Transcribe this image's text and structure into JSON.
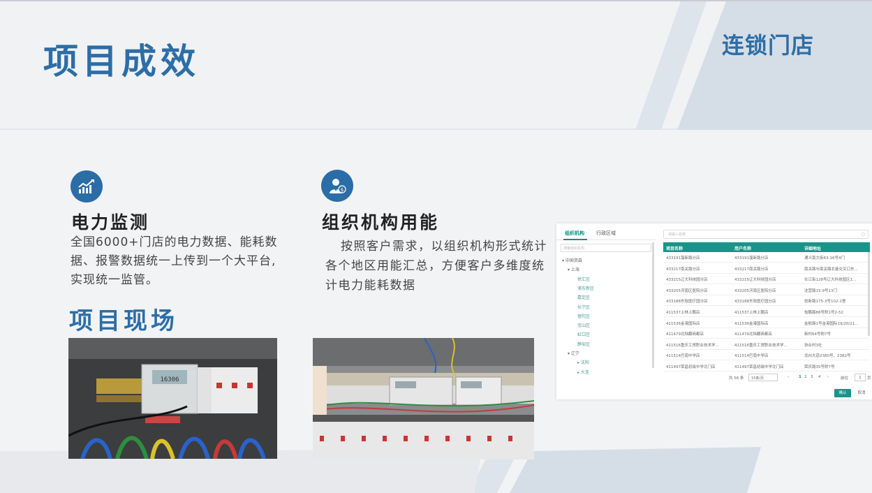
{
  "header": {
    "title": "项目成效",
    "corner_title": "连锁门店"
  },
  "features": [
    {
      "icon": "chart-growth-icon",
      "title": "电力监测",
      "desc_lines": [
        "全国6000+门店的电力数据、能耗数",
        "据、报警数据统一上传到一个大平台,",
        "实现统一监管。"
      ]
    },
    {
      "icon": "user-money-icon",
      "title": "组织机构用能",
      "desc_lines": [
        "按照客户需求，以组织机构形式统计",
        "各个地区用能汇总，方便客户多维度统",
        "计电力能耗数据"
      ]
    }
  ],
  "site_section": {
    "title": "项目现场"
  },
  "app_panel": {
    "tabs": [
      "组织机构",
      "行政区域"
    ],
    "tree_search_placeholder": "搜索组织机构",
    "search_placeholder": "请输入名称",
    "tree": [
      {
        "label": "▾ 中国资森",
        "level": 0
      },
      {
        "label": "▾ 上海",
        "level": 1
      },
      {
        "label": "徐汇区",
        "level": 2
      },
      {
        "label": "浦东新区",
        "level": 2
      },
      {
        "label": "嘉定区",
        "level": 2
      },
      {
        "label": "长宁区",
        "level": 2
      },
      {
        "label": "普陀区",
        "level": 2
      },
      {
        "label": "宝山区",
        "level": 2
      },
      {
        "label": "虹口区",
        "level": 2
      },
      {
        "label": "静安区",
        "level": 2
      },
      {
        "label": "▾ 辽宁",
        "level": 1
      },
      {
        "label": "▸ 沈阳",
        "level": 2
      },
      {
        "label": "▸ 大连",
        "level": 2
      }
    ],
    "columns": [
      "项目名称",
      "用户名称",
      "详细地址"
    ],
    "rows": [
      [
        "433191藻新路分店",
        "433191藻新路分店",
        "通义南大街63-16号4门"
      ],
      [
        "433217南关路分店",
        "433217南关路分店",
        "南关路与南关路北巷交叉口东..."
      ],
      [
        "433215辽大科技园分店",
        "433215辽大科技园分店",
        "长江街128号辽大科技园区1..."
      ],
      [
        "433205河南区医院分店",
        "433205河南区医院分店",
        "沈营路15-9号13门"
      ],
      [
        "433188东软医疗园分店",
        "433188东软医疗园分店",
        "创新路175-3号102-2室"
      ],
      [
        "411537上林上鹏店",
        "411537上林上鹏店",
        "怡鹏路88号附1号2-52"
      ],
      [
        "411536金港国际店",
        "411536金港国际店",
        "金航路1号金港国际19/20/21..."
      ],
      [
        "411479北陆翻商都店",
        "411479北陆翻商都店",
        "新村64号附7号"
      ],
      [
        "411516重庆工贸职业技术学...",
        "411516重庆工贸职业技术学...",
        "协合村3社"
      ],
      [
        "411514巴南中学店",
        "411514巴南中学店",
        "龙州大道2380号、2382号"
      ],
      [
        "411497荣昌初级中学北门店",
        "411497荣昌初级中学北门店",
        "荣庆路35号附7号"
      ]
    ],
    "pager": {
      "total": "共 56 条",
      "page_size": "15条/页",
      "pages": [
        "1",
        "2",
        "3",
        "4"
      ],
      "current_page": "1",
      "goto_label": "前往",
      "goto_value": "1",
      "page_unit": "页"
    },
    "confirm_label": "确认",
    "cancel_label": "取消"
  },
  "colors": {
    "brand_blue": "#2c6ea7",
    "teal": "#17958a",
    "background": "#f2f3f5"
  }
}
